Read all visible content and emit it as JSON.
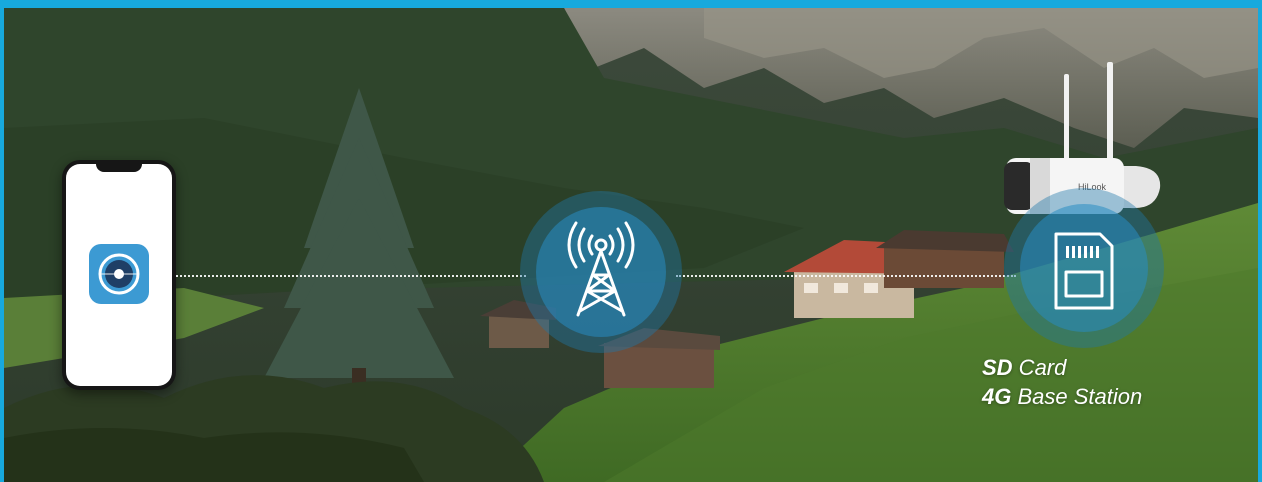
{
  "caption": {
    "line1": {
      "bold": "SD",
      "rest": " Card"
    },
    "line2": {
      "bold": "4G",
      "rest": " Base Station"
    }
  },
  "camera": {
    "brand": "HiLook"
  },
  "icons": {
    "phone": "smartphone-icon",
    "app": "camera-app-icon",
    "tower": "cell-tower-icon",
    "sd": "sd-card-icon",
    "camera": "bullet-camera-icon"
  },
  "colors": {
    "border": "#17a9dd",
    "badge": "#2a8cc3",
    "app_icon": "#3c9ad3",
    "text": "#ffffff"
  }
}
